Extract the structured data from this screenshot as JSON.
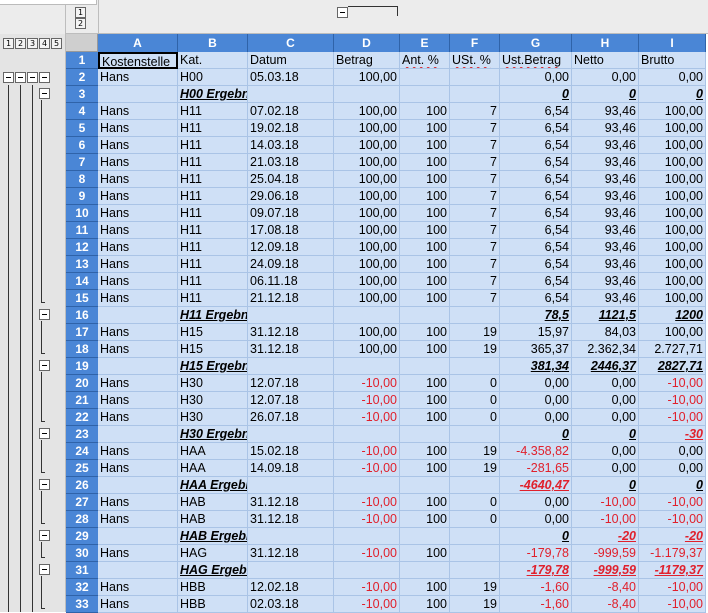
{
  "column_levels": [
    "1",
    "2"
  ],
  "row_levels": [
    "1",
    "2",
    "3",
    "4",
    "5"
  ],
  "columns": [
    "A",
    "B",
    "C",
    "D",
    "E",
    "F",
    "G",
    "H",
    "I"
  ],
  "headers": [
    "Kostenstelle",
    "Kat.",
    "Datum",
    "Betrag",
    "Ant. %",
    "USt. %",
    "Ust.Betrag",
    "Netto",
    "Brutto"
  ],
  "rows": [
    {
      "n": "2",
      "cells": [
        "Hans",
        "H00",
        "05.03.18",
        "100,00",
        "",
        "",
        "0,00",
        "0,00",
        "0,00"
      ]
    },
    {
      "n": "3",
      "sub": true,
      "cells": [
        "",
        "H00 Ergebnis",
        "",
        "",
        "",
        "",
        "0",
        "0",
        "0"
      ]
    },
    {
      "n": "4",
      "cells": [
        "Hans",
        "H11",
        "07.02.18",
        "100,00",
        "100",
        "7",
        "6,54",
        "93,46",
        "100,00"
      ]
    },
    {
      "n": "5",
      "cells": [
        "Hans",
        "H11",
        "19.02.18",
        "100,00",
        "100",
        "7",
        "6,54",
        "93,46",
        "100,00"
      ]
    },
    {
      "n": "6",
      "cells": [
        "Hans",
        "H11",
        "14.03.18",
        "100,00",
        "100",
        "7",
        "6,54",
        "93,46",
        "100,00"
      ]
    },
    {
      "n": "7",
      "cells": [
        "Hans",
        "H11",
        "21.03.18",
        "100,00",
        "100",
        "7",
        "6,54",
        "93,46",
        "100,00"
      ]
    },
    {
      "n": "8",
      "cells": [
        "Hans",
        "H11",
        "25.04.18",
        "100,00",
        "100",
        "7",
        "6,54",
        "93,46",
        "100,00"
      ]
    },
    {
      "n": "9",
      "cells": [
        "Hans",
        "H11",
        "29.06.18",
        "100,00",
        "100",
        "7",
        "6,54",
        "93,46",
        "100,00"
      ]
    },
    {
      "n": "10",
      "cells": [
        "Hans",
        "H11",
        "09.07.18",
        "100,00",
        "100",
        "7",
        "6,54",
        "93,46",
        "100,00"
      ]
    },
    {
      "n": "11",
      "cells": [
        "Hans",
        "H11",
        "17.08.18",
        "100,00",
        "100",
        "7",
        "6,54",
        "93,46",
        "100,00"
      ]
    },
    {
      "n": "12",
      "cells": [
        "Hans",
        "H11",
        "12.09.18",
        "100,00",
        "100",
        "7",
        "6,54",
        "93,46",
        "100,00"
      ]
    },
    {
      "n": "13",
      "cells": [
        "Hans",
        "H11",
        "24.09.18",
        "100,00",
        "100",
        "7",
        "6,54",
        "93,46",
        "100,00"
      ]
    },
    {
      "n": "14",
      "cells": [
        "Hans",
        "H11",
        "06.11.18",
        "100,00",
        "100",
        "7",
        "6,54",
        "93,46",
        "100,00"
      ]
    },
    {
      "n": "15",
      "cells": [
        "Hans",
        "H11",
        "21.12.18",
        "100,00",
        "100",
        "7",
        "6,54",
        "93,46",
        "100,00"
      ]
    },
    {
      "n": "16",
      "sub": true,
      "cells": [
        "",
        "H11 Ergebnis",
        "",
        "",
        "",
        "",
        "78,5",
        "1121,5",
        "1200"
      ]
    },
    {
      "n": "17",
      "cells": [
        "Hans",
        "H15",
        "31.12.18",
        "100,00",
        "100",
        "19",
        "15,97",
        "84,03",
        "100,00"
      ]
    },
    {
      "n": "18",
      "cells": [
        "Hans",
        "H15",
        "31.12.18",
        "100,00",
        "100",
        "19",
        "365,37",
        "2.362,34",
        "2.727,71"
      ]
    },
    {
      "n": "19",
      "sub": true,
      "cells": [
        "",
        "H15 Ergebnis",
        "",
        "",
        "",
        "",
        "381,34",
        "2446,37",
        "2827,71"
      ]
    },
    {
      "n": "20",
      "cells": [
        "Hans",
        "H30",
        "12.07.18",
        "-10,00",
        "100",
        "0",
        "0,00",
        "0,00",
        "-10,00"
      ]
    },
    {
      "n": "21",
      "cells": [
        "Hans",
        "H30",
        "12.07.18",
        "-10,00",
        "100",
        "0",
        "0,00",
        "0,00",
        "-10,00"
      ]
    },
    {
      "n": "22",
      "cells": [
        "Hans",
        "H30",
        "26.07.18",
        "-10,00",
        "100",
        "0",
        "0,00",
        "0,00",
        "-10,00"
      ]
    },
    {
      "n": "23",
      "sub": true,
      "cells": [
        "",
        "H30 Ergebnis",
        "",
        "",
        "",
        "",
        "0",
        "0",
        "-30"
      ]
    },
    {
      "n": "24",
      "cells": [
        "Hans",
        "HAA",
        "15.02.18",
        "-10,00",
        "100",
        "19",
        "-4.358,82",
        "0,00",
        "0,00"
      ]
    },
    {
      "n": "25",
      "cells": [
        "Hans",
        "HAA",
        "14.09.18",
        "-10,00",
        "100",
        "19",
        "-281,65",
        "0,00",
        "0,00"
      ]
    },
    {
      "n": "26",
      "sub": true,
      "cells": [
        "",
        "HAA Ergebnis",
        "",
        "",
        "",
        "",
        "-4640,47",
        "0",
        "0"
      ]
    },
    {
      "n": "27",
      "cells": [
        "Hans",
        "HAB",
        "31.12.18",
        "-10,00",
        "100",
        "0",
        "0,00",
        "-10,00",
        "-10,00"
      ]
    },
    {
      "n": "28",
      "cells": [
        "Hans",
        "HAB",
        "31.12.18",
        "-10,00",
        "100",
        "0",
        "0,00",
        "-10,00",
        "-10,00"
      ]
    },
    {
      "n": "29",
      "sub": true,
      "cells": [
        "",
        "HAB Ergebnis",
        "",
        "",
        "",
        "",
        "0",
        "-20",
        "-20"
      ]
    },
    {
      "n": "30",
      "cells": [
        "Hans",
        "HAG",
        "31.12.18",
        "-10,00",
        "100",
        "",
        "-179,78",
        "-999,59",
        "-1.179,37"
      ]
    },
    {
      "n": "31",
      "sub": true,
      "cells": [
        "",
        "HAG Ergebnis",
        "",
        "",
        "",
        "",
        "-179,78",
        "-999,59",
        "-1179,37"
      ]
    },
    {
      "n": "32",
      "cells": [
        "Hans",
        "HBB",
        "12.02.18",
        "-10,00",
        "100",
        "19",
        "-1,60",
        "-8,40",
        "-10,00"
      ]
    },
    {
      "n": "33",
      "cells": [
        "Hans",
        "HBB",
        "02.03.18",
        "-10,00",
        "100",
        "19",
        "-1,60",
        "-8,40",
        "-10,00"
      ]
    }
  ]
}
